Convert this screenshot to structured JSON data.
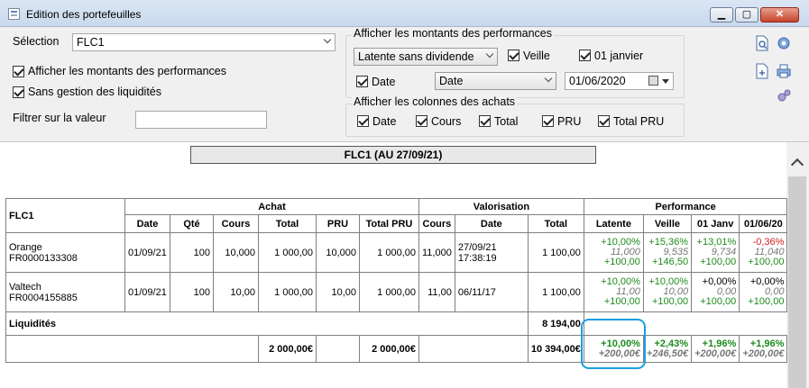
{
  "window": {
    "title": "Edition des portefeuilles",
    "minimize": "▁",
    "maximize": "▢",
    "close": "✕"
  },
  "controls": {
    "selection_label": "Sélection",
    "selection_value": "FLC1",
    "show_perf_amounts": {
      "label": "Afficher les montants des performances",
      "checked": true
    },
    "no_liquidity": {
      "label": "Sans gestion des liquidités",
      "checked": true
    },
    "filter_label": "Filtrer sur la valeur",
    "filter_value": "",
    "perf_group": {
      "title": "Afficher les montants des performances",
      "type_value": "Latente sans dividende",
      "veille": {
        "label": "Veille",
        "checked": true
      },
      "jan": {
        "label": "01 janvier",
        "checked": true
      },
      "date": {
        "label": "Date",
        "checked": true
      },
      "date_select": "Date",
      "date_input": "01/06/2020"
    },
    "purchase_group": {
      "title": "Afficher les colonnes des achats",
      "cols": [
        {
          "label": "Date",
          "checked": true
        },
        {
          "label": "Cours",
          "checked": true
        },
        {
          "label": "Total",
          "checked": true
        },
        {
          "label": "PRU",
          "checked": true
        },
        {
          "label": "Total PRU",
          "checked": true
        }
      ]
    }
  },
  "report": {
    "title": "FLC1 (AU 27/09/21)",
    "headers": {
      "portfolio": "FLC1",
      "achat": "Achat",
      "valorisation": "Valorisation",
      "performance": "Performance",
      "achat_cols": [
        "Date",
        "Qté",
        "Cours",
        "Total",
        "PRU",
        "Total PRU"
      ],
      "valo_cols": [
        "Cours",
        "Date",
        "Total"
      ],
      "perf_cols": [
        "Latente",
        "Veille",
        "01 Janv",
        "01/06/20"
      ]
    },
    "rows": [
      {
        "name": "Orange",
        "isin": "FR0000133308",
        "date": "01/09/21",
        "qty": "100",
        "cours": "10,000",
        "total": "1 000,00",
        "pru": "10,000",
        "total_pru": "1 000,00",
        "v_cours": "11,000",
        "v_date": "27/09/21",
        "v_time": "17:38:19",
        "v_total": "1 100,00",
        "perf": [
          {
            "pct": "+10,00%",
            "ref": "11,000",
            "amt": "+100,00"
          },
          {
            "pct": "+15,36%",
            "ref": "9,535",
            "amt": "+146,50"
          },
          {
            "pct": "+13,01%",
            "ref": "9,734",
            "amt": "+100,00"
          },
          {
            "pct": "-0,36%",
            "ref": "11,040",
            "amt": "+100,00"
          }
        ]
      },
      {
        "name": "Valtech",
        "isin": "FR0004155885",
        "date": "01/09/21",
        "qty": "100",
        "cours": "10,00",
        "total": "1 000,00",
        "pru": "10,00",
        "total_pru": "1 000,00",
        "v_cours": "11,00",
        "v_date": "06/11/17",
        "v_time": "",
        "v_total": "1 100,00",
        "perf": [
          {
            "pct": "+10,00%",
            "ref": "11,00",
            "amt": "+100,00"
          },
          {
            "pct": "+10,00%",
            "ref": "10,00",
            "amt": "+100,00"
          },
          {
            "pct": "+0,00%",
            "ref": "0,00",
            "amt": "+100,00"
          },
          {
            "pct": "+0,00%",
            "ref": "0,00",
            "amt": "+100,00"
          }
        ]
      }
    ],
    "liquidity": {
      "label": "Liquidités",
      "value": "8 194,00"
    },
    "totals": {
      "total": "2 000,00€",
      "total_pru": "2 000,00€",
      "v_total": "10 394,00€",
      "perf": [
        {
          "pct": "+10,00%",
          "amt": "+200,00€"
        },
        {
          "pct": "+2,43%",
          "amt": "+246,50€"
        },
        {
          "pct": "+1,96%",
          "amt": "+200,00€"
        },
        {
          "pct": "+1,96%",
          "amt": "+200,00€"
        }
      ]
    }
  },
  "colors": {
    "positive": "#1d8a1d",
    "negative": "#d01e1e",
    "highlight": "#1aa0e0"
  },
  "icons": [
    "document-search-icon",
    "settings-icon",
    "export-icon",
    "print-icon",
    "gears-icon"
  ]
}
